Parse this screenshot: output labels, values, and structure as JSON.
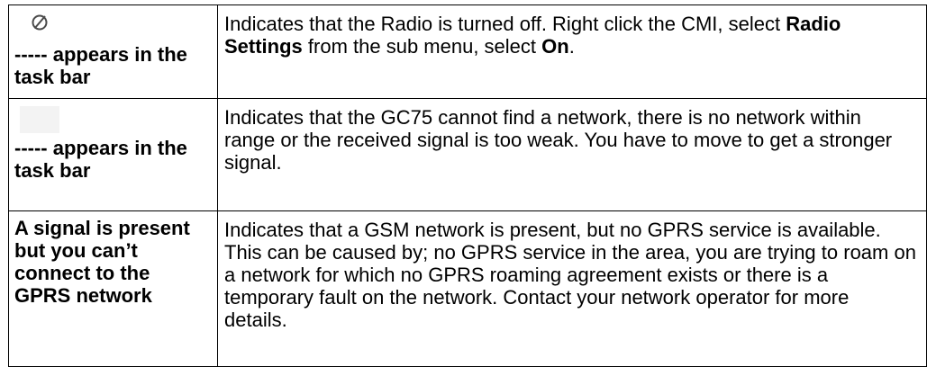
{
  "rows": [
    {
      "icon": "radio-off-icon",
      "symptom_prefix": "-----",
      "symptom_text": " appears in the task bar",
      "description": {
        "part1": "Indicates that the Radio is turned off. Right click the CMI, select ",
        "bold1": "Radio Settings",
        "part2": " from the sub menu, select ",
        "bold2": "On",
        "part3": "."
      }
    },
    {
      "icon": "blank-signal-icon",
      "symptom_prefix": "-----",
      "symptom_text": " appears in the task bar",
      "description": "Indicates that the GC75 cannot find a network, there is no network within range or the received signal is too weak. You have to move to get a stronger signal."
    },
    {
      "symptom_text": "A signal is present but you can’t connect to the GPRS network",
      "description": "Indicates that a GSM network is present, but no GPRS service is available. This can be caused by; no GPRS service in the area, you are trying to roam on a network for which no GPRS roaming agreement exists or there is a temporary fault on the network. Contact your network operator for more details."
    }
  ]
}
